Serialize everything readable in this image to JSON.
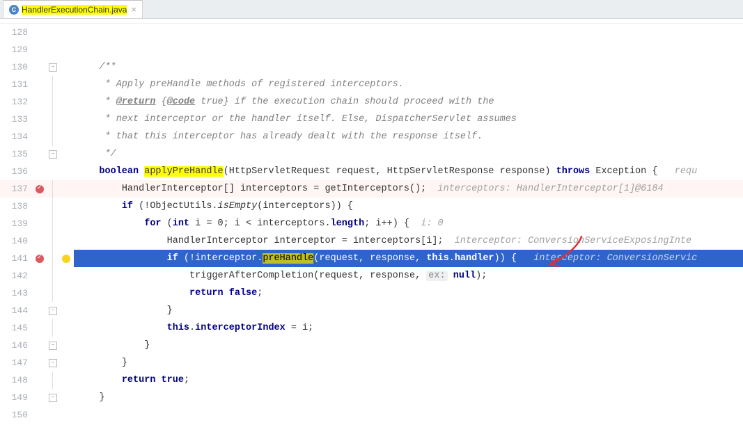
{
  "tab": {
    "icon_letter": "C",
    "filename": "HandlerExecutionChain.java",
    "close_glyph": "×"
  },
  "lines": {
    "128": "",
    "129": "",
    "130": "/**",
    "131": " * Apply preHandle methods of registered interceptors.",
    "132_prefix": " * ",
    "132_return": "@return",
    "132_mid": " {",
    "132_code": "@code",
    "132_suffix": " true} if the execution chain should proceed with the",
    "133": " * next interceptor or the handler itself. Else, DispatcherServlet assumes",
    "134": " * that this interceptor has already dealt with the response itself.",
    "135": " */",
    "136_kw1": "boolean",
    "136_method": "applyPreHandle",
    "136_sig": "(HttpServletRequest request, HttpServletResponse response) ",
    "136_kw2": "throws",
    "136_kw3": " Exception {   ",
    "136_hint": "requ",
    "137_text": "HandlerInterceptor[] interceptors = getInterceptors();  ",
    "137_hint": "interceptors: HandlerInterceptor[1]@6184",
    "138_kw": "if",
    "138_text": " (!ObjectUtils.",
    "138_method": "isEmpty",
    "138_text2": "(interceptors)) {",
    "139_kw1": "for",
    "139_text1": " (",
    "139_kw2": "int",
    "139_text2": " i = 0; i < interceptors.",
    "139_field": "length",
    "139_text3": "; i++) {  ",
    "139_hint": "i: 0",
    "140_text": "HandlerInterceptor interceptor = interceptors[i];  ",
    "140_hint": "interceptor: ConversionServiceExposingInte",
    "141_kw": "if",
    "141_text1": " (!interceptor.",
    "141_method": "preHandle",
    "141_text2": "(request, response, ",
    "141_kw2": "this",
    "141_text3": ".",
    "141_field": "handler",
    "141_text4": ")) {   ",
    "141_hint": "interceptor: ConversionServic",
    "142_text1": "triggerAfterCompletion(request, response, ",
    "142_hintbox": "ex:",
    "142_kw": "null",
    "142_text2": ");",
    "143_kw": "return false",
    "143_text": ";",
    "144": "}",
    "145_kw": "this",
    "145_text": ".",
    "145_field": "interceptorIndex",
    "145_text2": " = i;",
    "146": "}",
    "147": "}",
    "148_kw": "return true",
    "148_text": ";",
    "149": "}",
    "150": ""
  },
  "line_numbers": [
    "128",
    "129",
    "130",
    "131",
    "132",
    "133",
    "134",
    "135",
    "136",
    "137",
    "138",
    "139",
    "140",
    "141",
    "142",
    "143",
    "144",
    "145",
    "146",
    "147",
    "148",
    "149",
    "150"
  ]
}
